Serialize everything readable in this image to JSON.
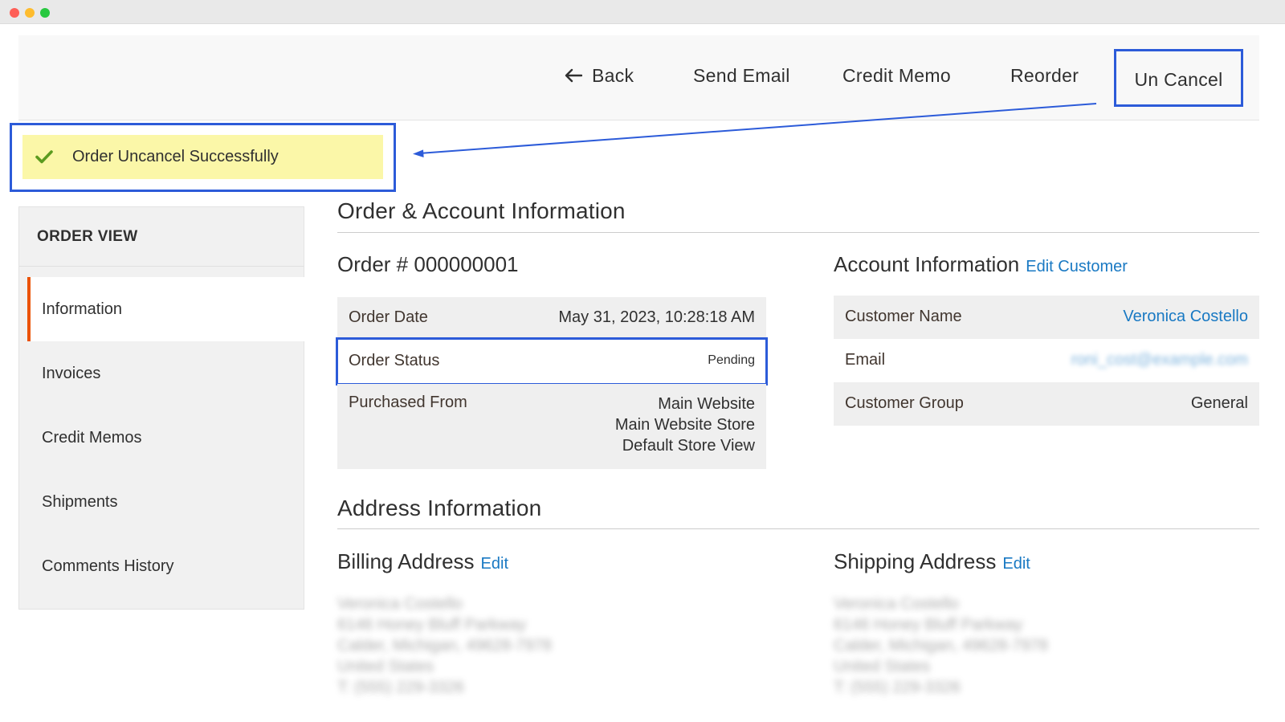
{
  "toolbar": {
    "back_label": "Back",
    "send_email_label": "Send Email",
    "credit_memo_label": "Credit Memo",
    "reorder_label": "Reorder",
    "uncancel_label": "Un Cancel"
  },
  "message": {
    "text": "Order Uncancel Successfully"
  },
  "sidebar": {
    "title": "ORDER VIEW",
    "items": [
      {
        "label": "Information",
        "active": true
      },
      {
        "label": "Invoices"
      },
      {
        "label": "Credit Memos"
      },
      {
        "label": "Shipments"
      },
      {
        "label": "Comments History"
      }
    ]
  },
  "order_account": {
    "section_title": "Order & Account Information",
    "order": {
      "title": "Order # 000000001",
      "date_label": "Order Date",
      "date_value": "May 31, 2023, 10:28:18 AM",
      "status_label": "Order Status",
      "status_value": "Pending",
      "purchased_label": "Purchased From",
      "purchased_lines": [
        "Main Website",
        "Main Website Store",
        "Default Store View"
      ]
    },
    "account": {
      "title": "Account Information",
      "edit_link": "Edit Customer",
      "name_label": "Customer Name",
      "name_value": "Veronica Costello",
      "email_label": "Email",
      "email_value": "roni_cost@example.com",
      "group_label": "Customer Group",
      "group_value": "General"
    }
  },
  "address": {
    "section_title": "Address Information",
    "billing": {
      "title": "Billing Address",
      "edit_link": "Edit",
      "lines": [
        "Veronica Costello",
        "6146 Honey Bluff Parkway",
        "Calder, Michigan, 49628-7978",
        "United States",
        "T: (555) 229-3326"
      ]
    },
    "shipping": {
      "title": "Shipping Address",
      "edit_link": "Edit",
      "lines": [
        "Veronica Costello",
        "6146 Honey Bluff Parkway",
        "Calder, Michigan, 49628-7978",
        "United States",
        "T: (555) 229-3326"
      ]
    }
  },
  "colors": {
    "annotation_blue": "#2c5bd9",
    "active_accent": "#eb5202",
    "link": "#1979c3",
    "success_bg": "#fbf7a8",
    "check": "#5b9b1f"
  }
}
